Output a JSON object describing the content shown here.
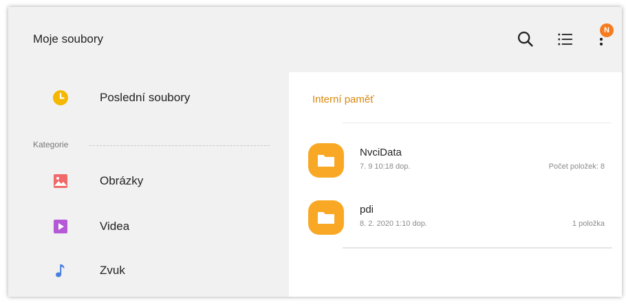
{
  "header": {
    "title": "Moje soubory",
    "search_icon": "search-icon",
    "list_view_icon": "list-view-icon",
    "more_icon": "more-vert-icon",
    "notification_badge": "N"
  },
  "sidebar": {
    "recent": {
      "label": "Poslední soubory",
      "icon": "clock-icon",
      "color": "#f5b700"
    },
    "category_label": "Kategorie",
    "items": [
      {
        "label": "Obrázky",
        "icon": "image-icon",
        "color": "#f06a6a"
      },
      {
        "label": "Videa",
        "icon": "video-icon",
        "color": "#b45ad6"
      },
      {
        "label": "Zvuk",
        "icon": "music-note-icon",
        "color": "#4a7fe0"
      }
    ]
  },
  "main": {
    "section_title": "Interní paměť",
    "folders": [
      {
        "name": "NvciData",
        "date": "7. 9 10:18 dop.",
        "count": "Počet položek: 8"
      },
      {
        "name": "pdi",
        "date": "8. 2. 2020 1:10 dop.",
        "count": "1 položka"
      }
    ]
  },
  "colors": {
    "accent": "#d9860b",
    "folder": "#f9a825",
    "badge": "#f47c20"
  }
}
